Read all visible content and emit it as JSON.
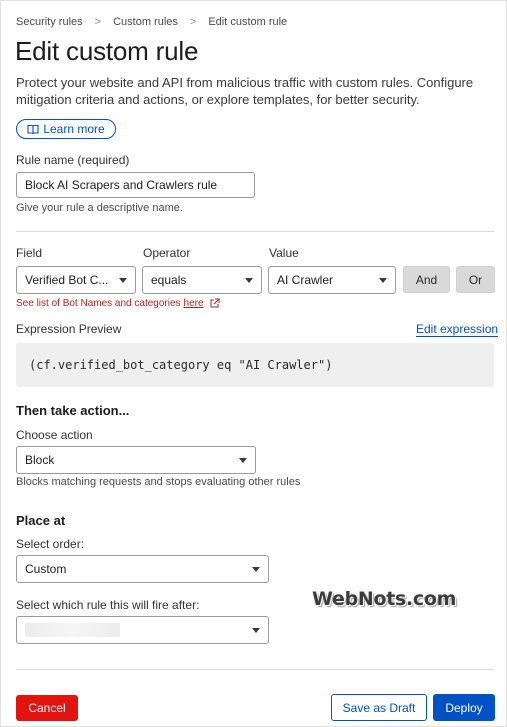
{
  "breadcrumb": {
    "items": [
      "Security rules",
      "Custom rules",
      "Edit custom rule"
    ],
    "separator": ">"
  },
  "page": {
    "title": "Edit custom rule",
    "description": "Protect your website and API from malicious traffic with custom rules. Configure mitigation criteria and actions, or explore templates, for better security.",
    "learn_more_label": "Learn more",
    "learn_more_icon": "book-icon"
  },
  "rule_name": {
    "label": "Rule name (required)",
    "value": "Block AI Scrapers and Crawlers rule",
    "help": "Give your rule a descriptive name."
  },
  "expression": {
    "field_label": "Field",
    "operator_label": "Operator",
    "value_label": "Value",
    "field_value": "Verified Bot C...",
    "operator_value": "equals",
    "value_value": "AI Crawler",
    "and_label": "And",
    "or_label": "Or",
    "bot_list_prefix": "See list of Bot Names and categories",
    "bot_list_link": "here",
    "preview_label": "Expression Preview",
    "edit_label": "Edit expression",
    "preview_code": "(cf.verified_bot_category eq \"AI Crawler\")"
  },
  "action": {
    "heading": "Then take action...",
    "choose_label": "Choose action",
    "value": "Block",
    "help": "Blocks matching requests and stops evaluating other rules"
  },
  "place": {
    "heading": "Place at",
    "order_label": "Select order:",
    "order_value": "Custom",
    "after_label": "Select which rule this will fire after:"
  },
  "watermark": "WebNots.com",
  "footer": {
    "cancel_label": "Cancel",
    "draft_label": "Save as Draft",
    "deploy_label": "Deploy"
  },
  "colors": {
    "accent": "#0051c3",
    "danger": "#e3140f",
    "link_red": "#b3261e"
  }
}
